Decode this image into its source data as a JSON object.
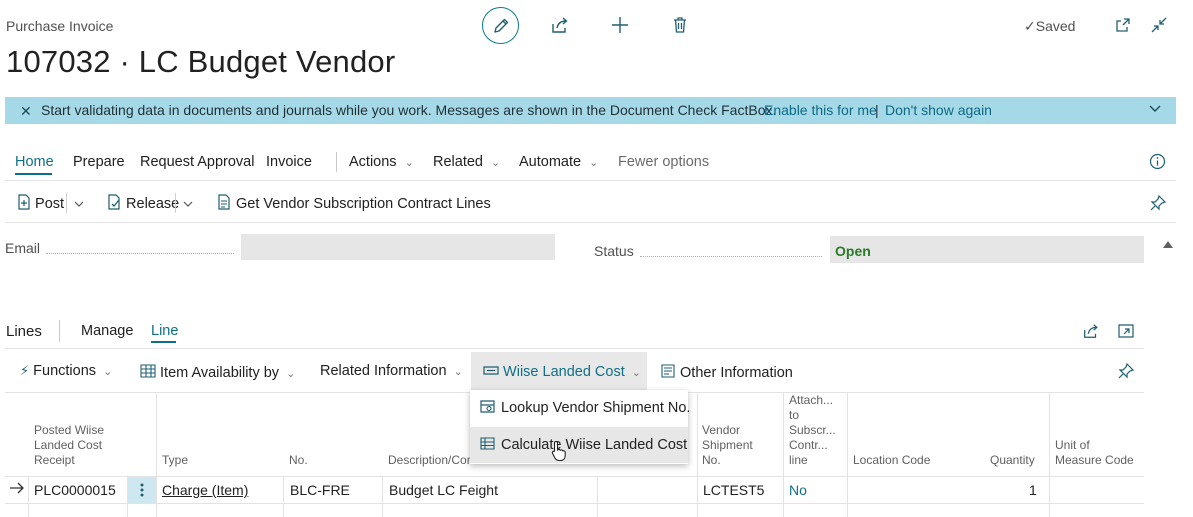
{
  "page": {
    "header_label": "Purchase Invoice",
    "title": "107032 · LC Budget Vendor",
    "saved_label": "Saved",
    "icons": [
      "edit-icon",
      "share-icon",
      "add-icon",
      "delete-icon",
      "open-new-window-icon",
      "collapse-icon"
    ]
  },
  "banner": {
    "text": "Start validating data in documents and journals while you work. Messages are shown in the Document Check FactBox.",
    "enable_link": "Enable this for me",
    "separator": "|",
    "dismiss_link": "Don't show again"
  },
  "menu": {
    "items": [
      "Home",
      "Prepare",
      "Request Approval",
      "Invoice"
    ],
    "dropdowns": [
      "Actions",
      "Related",
      "Automate"
    ],
    "fewer_options": "Fewer options"
  },
  "actions": {
    "post": "Post",
    "release": "Release",
    "get_lines": "Get Vendor Subscription Contract Lines"
  },
  "fields": {
    "email_label": "Email",
    "email_value": "",
    "status_label": "Status",
    "status_value": "Open"
  },
  "lines": {
    "title": "Lines",
    "tabs": [
      "Manage",
      "Line"
    ],
    "toolbar": {
      "functions": "Functions",
      "item_availability": "Item Availability by",
      "related_information": "Related Information",
      "wiise_landed_cost": "Wiise Landed Cost",
      "other_information": "Other Information"
    },
    "dropdown": {
      "lookup": "Lookup Vendor Shipment No.",
      "calculate": "Calculate Wiise Landed Cost"
    },
    "columns": {
      "posted_receipt": [
        "Posted Wiise",
        "Landed Cost",
        "Receipt"
      ],
      "type": "Type",
      "no": "No.",
      "description": "Description/Comment",
      "no2": "No.",
      "vendor_shipment": [
        "Vendor",
        "Shipment",
        "No."
      ],
      "attach": [
        "Attach...",
        "to",
        "Subscr...",
        "Contr...",
        "line"
      ],
      "location": "Location Code",
      "quantity": "Quantity",
      "uom": [
        "Unit of",
        "Measure Code"
      ]
    },
    "row": {
      "posted_receipt": "PLC0000015",
      "type": "Charge (Item)",
      "no": "BLC-FRE",
      "description": "Budget LC Feight",
      "vendor_shipment": "LCTEST5",
      "attach": "No",
      "quantity": "1"
    }
  },
  "colors": {
    "accent": "#0e6f86",
    "banner_bg": "#a6d9e8",
    "status_open": "#2a7a2a"
  }
}
